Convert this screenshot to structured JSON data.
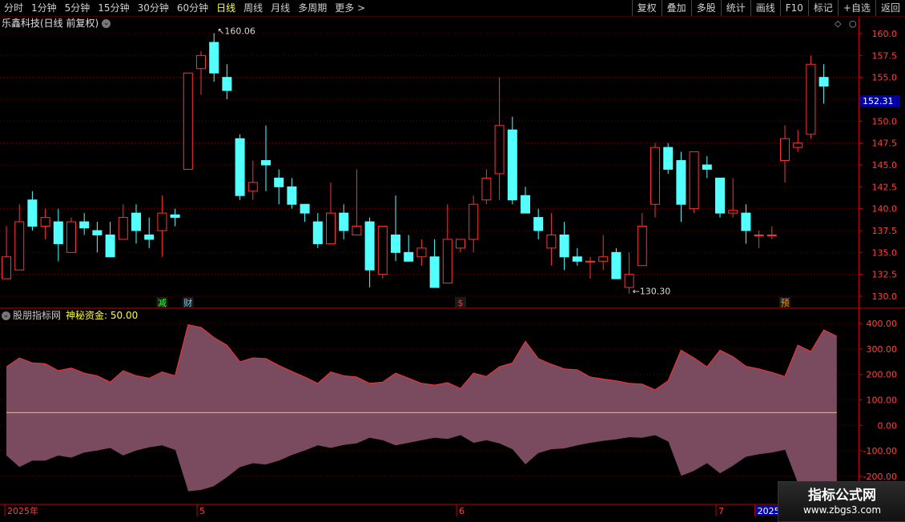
{
  "toolbar": {
    "periods": [
      "分时",
      "1分钟",
      "5分钟",
      "15分钟",
      "30分钟",
      "60分钟",
      "日线",
      "周线",
      "月线",
      "多周期",
      "更多 >"
    ],
    "active_period": "日线",
    "right_buttons": [
      "复权",
      "叠加",
      "多股",
      "统计",
      "画线",
      "F10",
      "标记",
      "+自选",
      "返回"
    ]
  },
  "stock": {
    "title": "乐鑫科技(日线 前复权)"
  },
  "indicator": {
    "name": "股朋指标网",
    "series_label": "神秘资金: 50.00"
  },
  "colors": {
    "up": "#ff3232",
    "down": "#54ffff",
    "grid": "#6a0000",
    "axis": "#c00000",
    "fill": "#7a4a5e",
    "outline": "#ff3030",
    "midline": "#ffcc00",
    "current": "#0000aa"
  },
  "watermark": {
    "name": "指标公式网",
    "url": "www.zbgs3.com"
  },
  "chart_data": [
    {
      "type": "candlestick",
      "title": "乐鑫科技(日线 前复权)",
      "ylim": [
        129,
        161.5
      ],
      "y_ticks": [
        "160.0",
        "157.5",
        "155.0",
        "152.5",
        "150.0",
        "147.5",
        "145.0",
        "142.5",
        "140.0",
        "137.5",
        "135.0",
        "132.5",
        "130.0"
      ],
      "current_price": "152.31",
      "high_annotation": "160.06",
      "low_annotation": "130.30",
      "event_markers": [
        {
          "index": 12,
          "label": "减",
          "color": "#33ff33"
        },
        {
          "index": 14,
          "label": "财",
          "color": "#66ccff"
        },
        {
          "index": 35,
          "label": "$",
          "color": "#ff3333"
        },
        {
          "index": 60,
          "label": "预",
          "color": "#ff9900"
        }
      ],
      "x_labels": [
        {
          "index": 0,
          "label": "2025年"
        },
        {
          "index": 15,
          "label": "5"
        },
        {
          "index": 35,
          "label": "6"
        },
        {
          "index": 55,
          "label": "7"
        },
        {
          "index": 58,
          "label": "2025/07"
        }
      ],
      "candles": [
        {
          "o": 132.0,
          "h": 138.0,
          "l": 132.0,
          "c": 134.5
        },
        {
          "o": 133.0,
          "h": 140.5,
          "l": 133.0,
          "c": 138.5
        },
        {
          "o": 141.0,
          "h": 142.0,
          "l": 137.5,
          "c": 138.0
        },
        {
          "o": 138.0,
          "h": 140.0,
          "l": 136.5,
          "c": 139.0
        },
        {
          "o": 138.5,
          "h": 140.0,
          "l": 134.0,
          "c": 136.0
        },
        {
          "o": 135.0,
          "h": 139.0,
          "l": 135.0,
          "c": 138.5
        },
        {
          "o": 138.5,
          "h": 139.5,
          "l": 137.0,
          "c": 137.8
        },
        {
          "o": 137.5,
          "h": 138.5,
          "l": 135.0,
          "c": 137.0
        },
        {
          "o": 137.0,
          "h": 138.5,
          "l": 134.5,
          "c": 134.5
        },
        {
          "o": 136.5,
          "h": 140.5,
          "l": 136.5,
          "c": 139.0
        },
        {
          "o": 139.5,
          "h": 140.5,
          "l": 136.0,
          "c": 137.5
        },
        {
          "o": 137.0,
          "h": 139.0,
          "l": 135.5,
          "c": 136.5
        },
        {
          "o": 137.5,
          "h": 141.5,
          "l": 134.5,
          "c": 139.5
        },
        {
          "o": 139.3,
          "h": 140.0,
          "l": 138.0,
          "c": 139.0
        },
        {
          "o": 144.5,
          "h": 155.5,
          "l": 144.5,
          "c": 155.5
        },
        {
          "o": 156.0,
          "h": 158.0,
          "l": 153.0,
          "c": 157.5
        },
        {
          "o": 159.0,
          "h": 160.06,
          "l": 154.5,
          "c": 155.5
        },
        {
          "o": 155.0,
          "h": 156.5,
          "l": 152.5,
          "c": 153.5
        },
        {
          "o": 148.0,
          "h": 148.5,
          "l": 141.0,
          "c": 141.5
        },
        {
          "o": 142.0,
          "h": 145.5,
          "l": 141.0,
          "c": 143.0
        },
        {
          "o": 145.5,
          "h": 149.5,
          "l": 142.0,
          "c": 145.0
        },
        {
          "o": 143.5,
          "h": 144.5,
          "l": 140.5,
          "c": 142.5
        },
        {
          "o": 142.5,
          "h": 143.5,
          "l": 140.0,
          "c": 140.5
        },
        {
          "o": 140.5,
          "h": 140.5,
          "l": 138.5,
          "c": 139.5
        },
        {
          "o": 138.5,
          "h": 139.5,
          "l": 135.5,
          "c": 136.0
        },
        {
          "o": 136.0,
          "h": 143.0,
          "l": 136.0,
          "c": 139.5
        },
        {
          "o": 139.5,
          "h": 140.5,
          "l": 136.5,
          "c": 137.5
        },
        {
          "o": 137.0,
          "h": 144.5,
          "l": 137.0,
          "c": 138.0
        },
        {
          "o": 138.5,
          "h": 139.0,
          "l": 131.0,
          "c": 133.0
        },
        {
          "o": 132.5,
          "h": 138.0,
          "l": 132.0,
          "c": 138.0
        },
        {
          "o": 137.0,
          "h": 141.5,
          "l": 134.0,
          "c": 135.0
        },
        {
          "o": 135.0,
          "h": 137.0,
          "l": 134.0,
          "c": 134.0
        },
        {
          "o": 134.5,
          "h": 136.5,
          "l": 133.5,
          "c": 135.5
        },
        {
          "o": 134.5,
          "h": 136.5,
          "l": 131.0,
          "c": 131.0
        },
        {
          "o": 131.5,
          "h": 140.5,
          "l": 131.5,
          "c": 136.5
        },
        {
          "o": 135.5,
          "h": 136.5,
          "l": 135.0,
          "c": 136.5
        },
        {
          "o": 136.5,
          "h": 141.5,
          "l": 135.0,
          "c": 140.5
        },
        {
          "o": 141.0,
          "h": 144.5,
          "l": 140.5,
          "c": 143.5
        },
        {
          "o": 144.0,
          "h": 155.0,
          "l": 141.0,
          "c": 149.5
        },
        {
          "o": 149.0,
          "h": 150.5,
          "l": 140.5,
          "c": 141.0
        },
        {
          "o": 141.5,
          "h": 142.5,
          "l": 139.5,
          "c": 139.5
        },
        {
          "o": 139.0,
          "h": 140.0,
          "l": 136.5,
          "c": 137.5
        },
        {
          "o": 135.5,
          "h": 139.5,
          "l": 133.5,
          "c": 137.0
        },
        {
          "o": 137.0,
          "h": 138.5,
          "l": 133.0,
          "c": 134.5
        },
        {
          "o": 134.5,
          "h": 135.5,
          "l": 133.5,
          "c": 134.0
        },
        {
          "o": 134.0,
          "h": 134.5,
          "l": 132.0,
          "c": 134.0
        },
        {
          "o": 134.0,
          "h": 137.0,
          "l": 133.0,
          "c": 134.5
        },
        {
          "o": 135.0,
          "h": 135.5,
          "l": 132.0,
          "c": 132.0
        },
        {
          "o": 131.0,
          "h": 135.0,
          "l": 130.3,
          "c": 132.5
        },
        {
          "o": 133.5,
          "h": 139.5,
          "l": 133.5,
          "c": 138.0
        },
        {
          "o": 140.5,
          "h": 147.5,
          "l": 139.0,
          "c": 147.0
        },
        {
          "o": 147.0,
          "h": 147.5,
          "l": 144.0,
          "c": 144.5
        },
        {
          "o": 145.5,
          "h": 146.5,
          "l": 138.5,
          "c": 140.5
        },
        {
          "o": 140.0,
          "h": 146.5,
          "l": 139.5,
          "c": 146.5
        },
        {
          "o": 145.0,
          "h": 146.0,
          "l": 143.5,
          "c": 144.5
        },
        {
          "o": 143.5,
          "h": 143.5,
          "l": 139.0,
          "c": 139.5
        },
        {
          "o": 139.5,
          "h": 143.5,
          "l": 139.0,
          "c": 139.8
        },
        {
          "o": 139.5,
          "h": 140.5,
          "l": 136.0,
          "c": 137.5
        },
        {
          "o": 137.0,
          "h": 137.5,
          "l": 135.5,
          "c": 137.0
        },
        {
          "o": 137.0,
          "h": 138.0,
          "l": 136.5,
          "c": 137.0
        },
        {
          "o": 145.5,
          "h": 149.5,
          "l": 143.0,
          "c": 148.0
        },
        {
          "o": 147.0,
          "h": 149.0,
          "l": 146.5,
          "c": 147.5
        },
        {
          "o": 148.5,
          "h": 157.5,
          "l": 148.0,
          "c": 156.5
        },
        {
          "o": 155.0,
          "h": 156.5,
          "l": 152.0,
          "c": 154.0
        }
      ]
    },
    {
      "type": "area",
      "title": "股朋指标网",
      "ylim": [
        -235,
        435
      ],
      "y_ticks": [
        "400.00",
        "300.00",
        "200.00",
        "100.00",
        "0.00",
        "-100.00",
        "-200.00"
      ],
      "midline": 50,
      "series": [
        {
          "name": "神秘资金",
          "values": [
            50
          ]
        },
        {
          "values": [
            230,
            265,
            245,
            242,
            215,
            225,
            205,
            195,
            170,
            215,
            195,
            185,
            210,
            195,
            395,
            385,
            345,
            315,
            250,
            265,
            262,
            235,
            212,
            190,
            165,
            210,
            195,
            190,
            165,
            170,
            205,
            185,
            165,
            158,
            168,
            145,
            205,
            192,
            230,
            245,
            330,
            262,
            240,
            222,
            218,
            190,
            182,
            175,
            165,
            162,
            140,
            175,
            295,
            265,
            230,
            295,
            270,
            232,
            222,
            208,
            192,
            315,
            290,
            375,
            350
          ]
        },
        {
          "values": [
            -120,
            -165,
            -140,
            -140,
            -120,
            -128,
            -108,
            -100,
            -90,
            -120,
            -100,
            -88,
            -80,
            -98,
            -260,
            -255,
            -240,
            -205,
            -165,
            -150,
            -155,
            -140,
            -118,
            -100,
            -80,
            -90,
            -78,
            -72,
            -50,
            -60,
            -80,
            -70,
            -60,
            -50,
            -55,
            -40,
            -70,
            -60,
            -72,
            -95,
            -155,
            -110,
            -95,
            -92,
            -80,
            -70,
            -62,
            -56,
            -48,
            -50,
            -40,
            -65,
            -200,
            -180,
            -150,
            -190,
            -160,
            -125,
            -115,
            -108,
            -98,
            -230,
            -225,
            -230,
            -230
          ]
        }
      ]
    }
  ]
}
